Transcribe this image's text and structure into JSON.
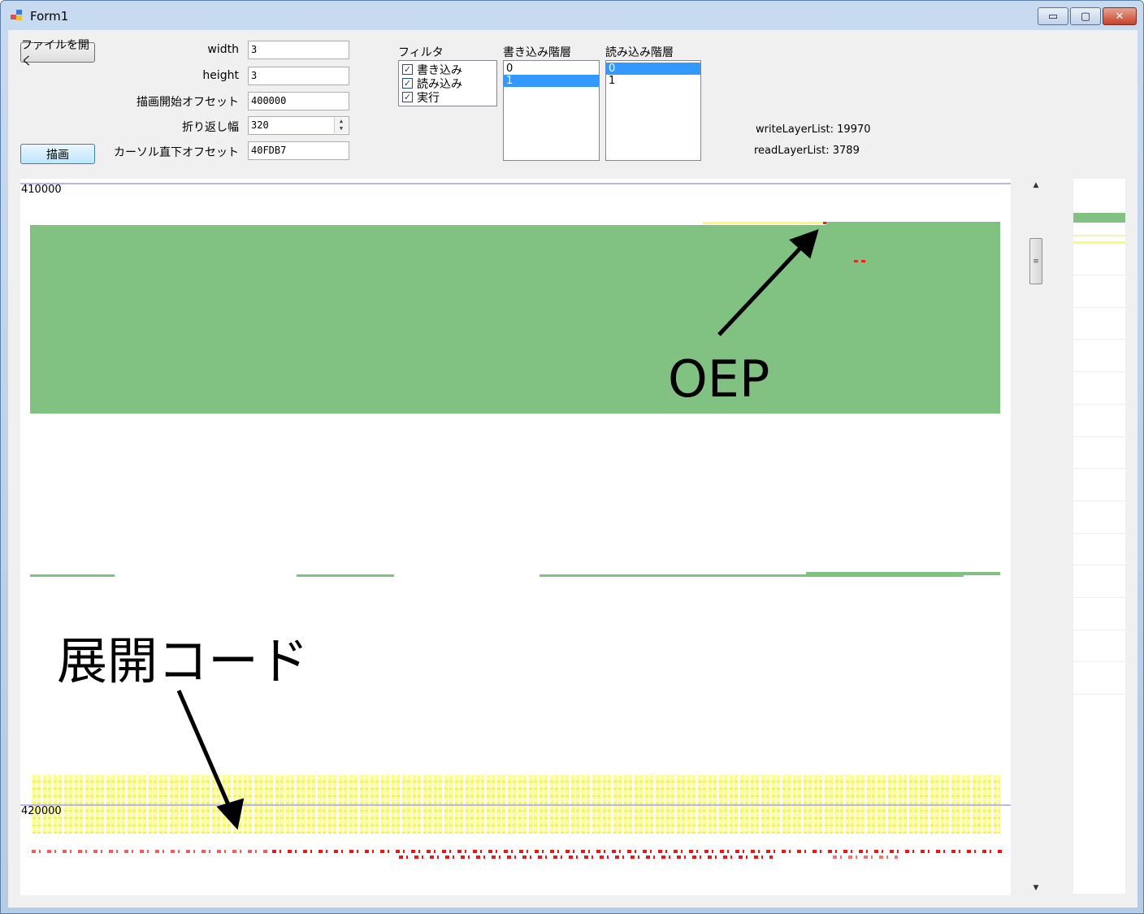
{
  "window": {
    "title": "Form1",
    "minimize": "▭",
    "maximize": "▢",
    "close": "✕"
  },
  "controls": {
    "open_file_label": "ファイルを開く",
    "draw_label": "描画",
    "width_label": "width",
    "width_value": "3",
    "height_label": "height",
    "height_value": "3",
    "start_offset_label": "描画開始オフセット",
    "start_offset_value": "400000",
    "wrap_width_label": "折り返し幅",
    "wrap_width_value": "320",
    "cursor_offset_label": "カーソル直下オフセット",
    "cursor_offset_value": "40FDB7"
  },
  "filter": {
    "label": "フィルタ",
    "items": [
      {
        "label": "書き込み",
        "checked": true
      },
      {
        "label": "読み込み",
        "checked": true
      },
      {
        "label": "実行",
        "checked": true
      }
    ]
  },
  "write_layers": {
    "label": "書き込み階層",
    "items": [
      "0",
      "1"
    ],
    "selected": "1"
  },
  "read_layers": {
    "label": "読み込み階層",
    "items": [
      "0",
      "1"
    ],
    "selected": "0"
  },
  "stats": {
    "write_layer_list": "writeLayerList: 19970",
    "read_layer_list": "readLayerList: 3789"
  },
  "canvas": {
    "offset_top": "410000",
    "offset_bottom": "420000",
    "colors": {
      "write": "#81c283",
      "read": "#fdfd6a",
      "exec": "#ee2020",
      "grid": "#b8b8ec"
    }
  },
  "annotations": {
    "oep": "OEP",
    "unpack_code": "展開コード"
  },
  "icons": {
    "scroll_up": "▲",
    "scroll_down": "▼",
    "grip": "≡"
  }
}
